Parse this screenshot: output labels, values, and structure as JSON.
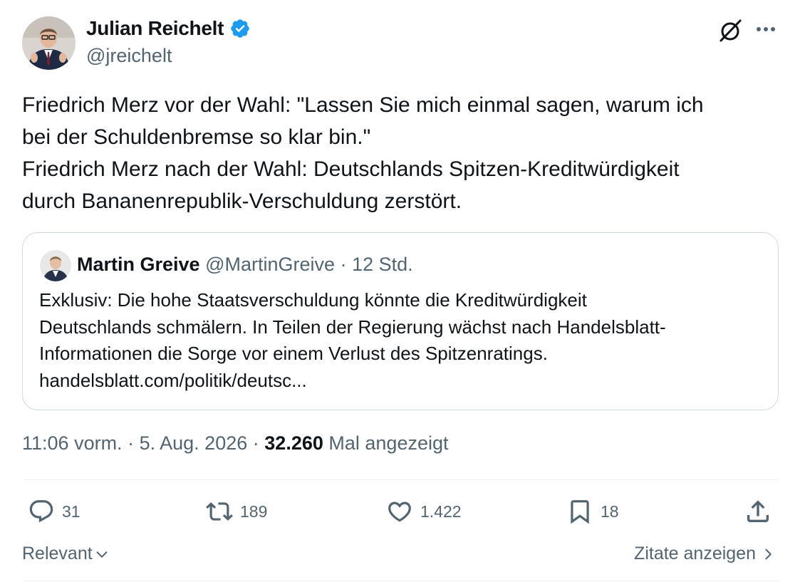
{
  "author": {
    "name": "Julian Reichelt",
    "handle": "@jreichelt",
    "verified": true
  },
  "tweet": {
    "lines": [
      "Friedrich Merz vor der Wahl: \"Lassen Sie mich einmal sagen, warum ich",
      "bei der Schuldenbremse so klar bin.\"",
      "Friedrich Merz nach der Wahl: Deutschlands Spitzen-Kreditwürdigkeit",
      "durch Bananenrepublik-Verschuldung zerstört."
    ]
  },
  "quote": {
    "name": "Martin Greive",
    "handle": "@MartinGreive",
    "separator": "·",
    "time": "12 Std.",
    "lines": [
      "Exklusiv: Die hohe Staatsverschuldung könnte die Kreditwürdigkeit",
      "Deutschlands schmälern. In Teilen der  Regierung wächst nach Handelsblatt-",
      "Informationen die Sorge vor einem Verlust des Spitzenratings.",
      "handelsblatt.com/politik/deutsc..."
    ]
  },
  "meta": {
    "time": "11:06 vorm.",
    "separator": "·",
    "date": "5. Aug. 2026",
    "views": "32.260",
    "views_label": "Mal angezeigt"
  },
  "actions": {
    "replies": "31",
    "reposts": "189",
    "likes": "1.422",
    "bookmarks": "18"
  },
  "footer": {
    "sort_label": "Relevant",
    "quotes_label": "Zitate anzeigen"
  },
  "colors": {
    "text": "#0f1419",
    "secondary": "#536471",
    "verified": "#1d9bf0",
    "border": "#cfd9de"
  },
  "icons": [
    "verified-badge-icon",
    "grok-icon",
    "more-icon",
    "reply-icon",
    "repost-icon",
    "like-icon",
    "bookmark-icon",
    "share-icon",
    "chevron-down-icon",
    "chevron-right-icon"
  ]
}
